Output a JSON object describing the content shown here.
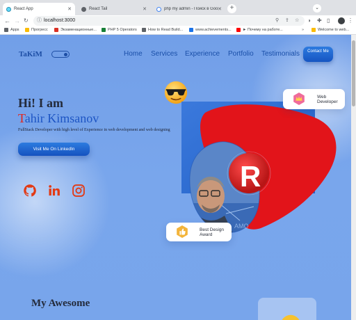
{
  "browser": {
    "tabs": [
      {
        "title": "React App",
        "active": true
      },
      {
        "title": "React Tail",
        "active": false
      },
      {
        "title": "php my admin - Поиск в Google",
        "active": false
      }
    ],
    "url": "localhost:3000",
    "bookmarks": [
      "Apps",
      "Прогресс",
      "Экзаменационные...",
      "PHP 5 Operators",
      "How to Read Build...",
      "www.achievements...",
      "► Почему на работе...",
      "Welcome to web..."
    ]
  },
  "page": {
    "logo": "TaKiM",
    "nav": [
      "Home",
      "Services",
      "Experience",
      "Portfolio",
      "Testimonials"
    ],
    "contact_label": "Contact Me",
    "greeting": "Hi! I am",
    "name_first_letter": "T",
    "name_rest": "ahir Kimsanov",
    "description": "FullStack Developer with high level of Experience in web development and web designing",
    "cta_label": "Visit Me On LinkedIn",
    "social_icons": [
      "github-icon",
      "linkedin-icon",
      "instagram-icon"
    ],
    "badge_web_line1": "Web",
    "badge_web_line2": "Developer",
    "badge_award_line1": "Best Design",
    "badge_award_line2": "Award",
    "section_title": "My Awesome",
    "logo_letter": "R",
    "colors": {
      "accent": "#1d55c4",
      "name_letter": "#e2231a",
      "blob_red": "#e2141a",
      "bg": "#729fe8"
    }
  }
}
